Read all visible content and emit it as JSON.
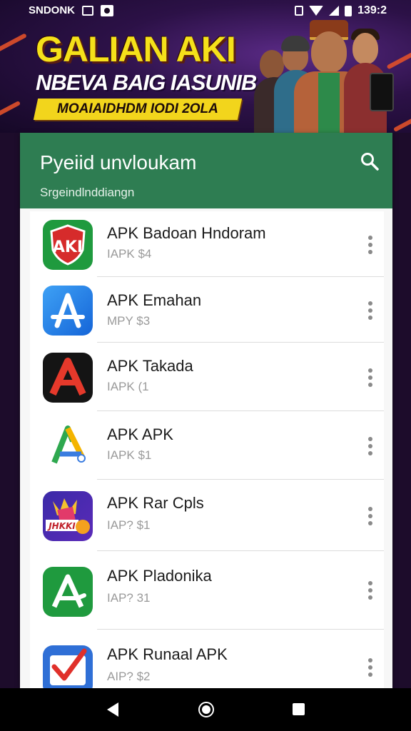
{
  "status_bar": {
    "carrier": "SNDONK",
    "time": "139:2",
    "icons": [
      "screenshot-icon",
      "image-icon",
      "vibrate-icon",
      "wifi-icon",
      "signal-icon",
      "battery-icon"
    ]
  },
  "banner": {
    "headline": "GALIAN AKI",
    "subline": "NBEVA BAIG IASUNIB",
    "ribbon": "MOAIAIDHDM IODI 2OLA"
  },
  "app_bar": {
    "title": "Pyeiid unvloukam",
    "subtitle": "Srgeindlnddiangn",
    "color": "#2e7d52"
  },
  "apps": [
    {
      "name": "APK Badoan Hndoram",
      "meta": "IAPK $4",
      "icon": "shield-badge-icon"
    },
    {
      "name": "APK Emahan",
      "meta": "MPY $3",
      "icon": "app-store-icon"
    },
    {
      "name": "APK Takada",
      "meta": "IAPK (1",
      "icon": "red-a-icon"
    },
    {
      "name": "APK APK",
      "meta": "IAPK $1",
      "icon": "drive-a-icon"
    },
    {
      "name": "APK Rar Cpls",
      "meta": "IAP? $1",
      "icon": "game-badge-icon"
    },
    {
      "name": "APK Pladonika",
      "meta": "IAP? 31",
      "icon": "green-a-icon"
    },
    {
      "name": "APK Runaal APK",
      "meta": "AIP? $2",
      "icon": "mail-check-icon"
    }
  ]
}
